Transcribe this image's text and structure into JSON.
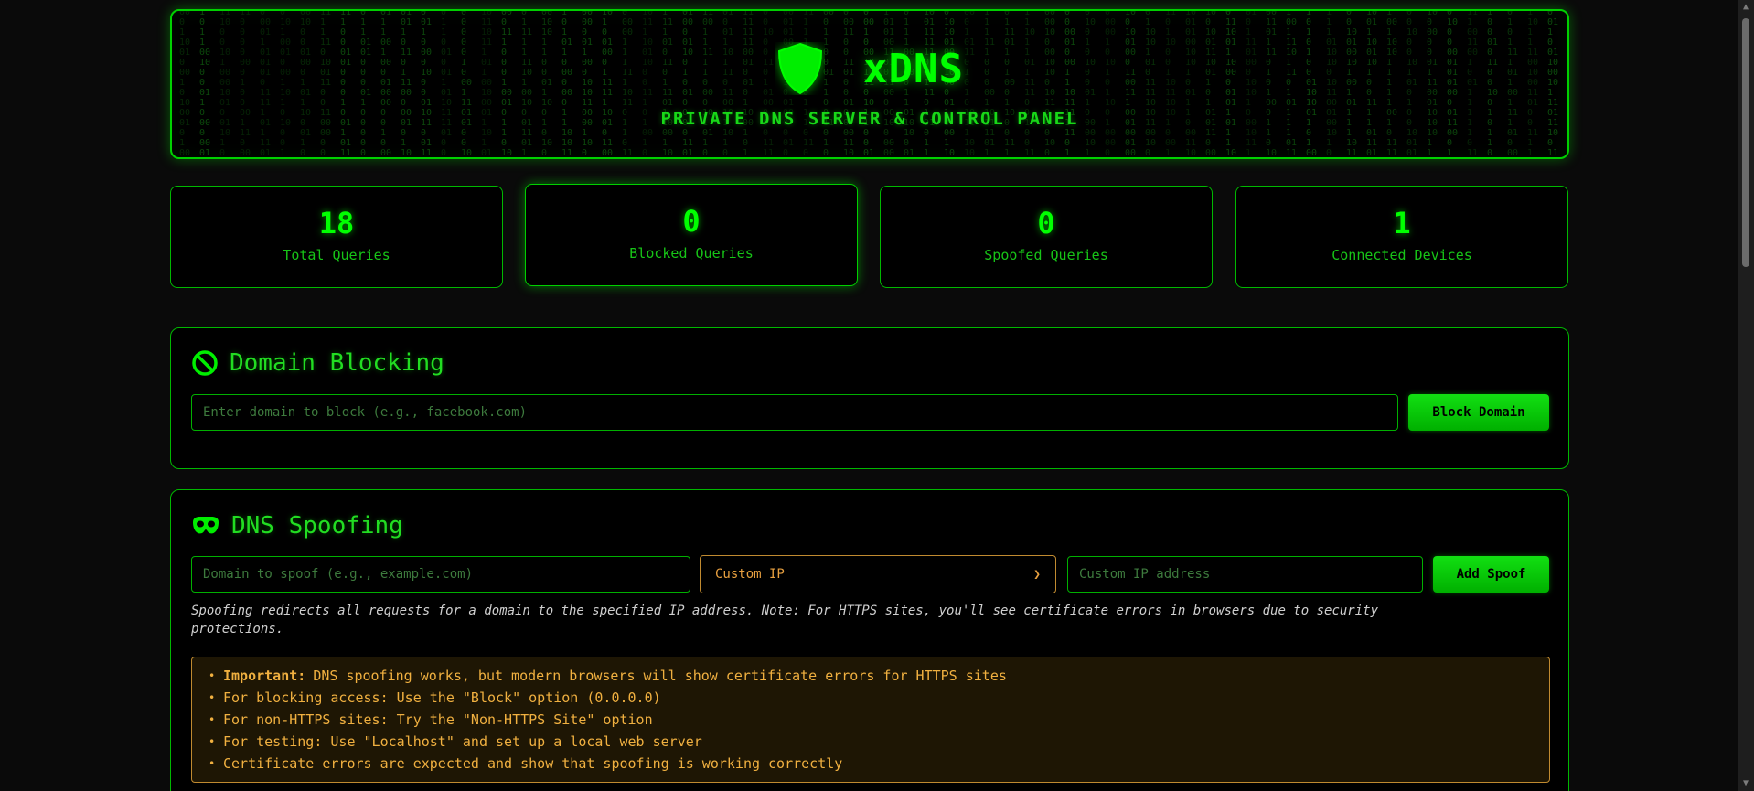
{
  "header": {
    "title": "xDNS",
    "subtitle": "PRIVATE DNS SERVER & CONTROL PANEL",
    "icon": "shield-icon"
  },
  "stats": [
    {
      "value": "18",
      "label": "Total Queries"
    },
    {
      "value": "0",
      "label": "Blocked Queries"
    },
    {
      "value": "0",
      "label": "Spoofed Queries"
    },
    {
      "value": "1",
      "label": "Connected Devices"
    }
  ],
  "blocking": {
    "title": "Domain Blocking",
    "icon": "ban-icon",
    "input_placeholder": "Enter domain to block (e.g., facebook.com)",
    "input_value": "",
    "button_label": "Block Domain"
  },
  "spoofing": {
    "title": "DNS Spoofing",
    "icon": "mask-icon",
    "domain_placeholder": "Domain to spoof (e.g., example.com)",
    "domain_value": "",
    "mode_selected": "Custom IP",
    "ip_placeholder": "Custom IP address",
    "ip_value": "",
    "button_label": "Add Spoof",
    "note": "Spoofing redirects all requests for a domain to the specified IP address. Note: For HTTPS sites, you'll see certificate errors in browsers due to security protections.",
    "warnings": [
      {
        "strong": "Important:",
        "text": "DNS spoofing works, but modern browsers will show certificate errors for HTTPS sites"
      },
      {
        "strong": "",
        "text": "For blocking access: Use the \"Block\" option (0.0.0.0)"
      },
      {
        "strong": "",
        "text": "For non-HTTPS sites: Try the \"Non-HTTPS Site\" option"
      },
      {
        "strong": "",
        "text": "For testing: Use \"Localhost\" and set up a local web server"
      },
      {
        "strong": "",
        "text": "Certificate errors are expected and show that spoofing is working correctly"
      }
    ]
  },
  "colors": {
    "accent": "#00ff00",
    "background": "#000000",
    "warning": "#f0b040"
  }
}
